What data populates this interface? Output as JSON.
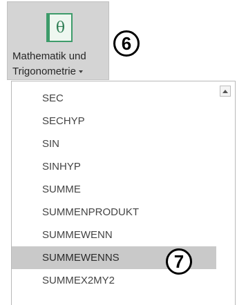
{
  "ribbon": {
    "button_line1": "Mathematik und",
    "button_line2": "Trigonometrie",
    "icon_glyph": "θ",
    "icon": "theta-function-icon",
    "dropdown_icon": "chevron-down-icon"
  },
  "callouts": {
    "step6": "6",
    "step7": "7"
  },
  "function_list": {
    "items": [
      "SEC",
      "SECHYP",
      "SIN",
      "SINHYP",
      "SUMME",
      "SUMMENPRODUKT",
      "SUMMEWENN",
      "SUMMEWENNS",
      "SUMMEX2MY2"
    ],
    "selected": "SUMMEWENNS",
    "scroll_up_icon": "scroll-up-arrow-icon"
  },
  "colors": {
    "ribbon_bg": "#d4d4d4",
    "icon_green": "#3d9b6a",
    "selected_bg": "#c9c9c9"
  }
}
